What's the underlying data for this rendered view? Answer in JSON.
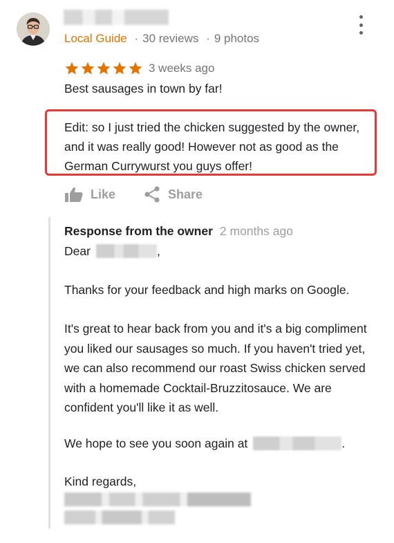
{
  "reviewer": {
    "badge": "Local Guide",
    "reviews": "30 reviews",
    "photos": "9 photos",
    "separator": "·"
  },
  "review": {
    "rating": 5,
    "rating_max": 5,
    "star_color": "#e37400",
    "time": "3 weeks ago",
    "text": "Best sausages in town by far!",
    "edit_text": "Edit: so I just tried the chicken suggested by the owner, and it was really good! However not as good as the German Currywurst you guys offer!",
    "highlight_color": "#e53935"
  },
  "actions": {
    "like_label": "Like",
    "share_label": "Share"
  },
  "owner_response": {
    "title": "Response from the owner",
    "time": "2 months ago",
    "greeting": "Dear",
    "greeting_suffix": ",",
    "paragraph1": "Thanks for your feedback and high marks on Google.",
    "paragraph2": "It's great to hear back from you and it's a big compliment you liked our sausages so much. If you haven't tried yet, we can also recommend our roast Swiss chicken served with a homemade Cocktail-Bruzzitosauce. We are confident you'll like it as well.",
    "paragraph3_prefix": "We hope to see you soon again at",
    "paragraph3_suffix": ".",
    "closing": "Kind regards,"
  },
  "icons": {
    "more": "more-vert-icon",
    "star": "star-icon",
    "like": "thumb-up-icon",
    "share": "share-icon"
  }
}
